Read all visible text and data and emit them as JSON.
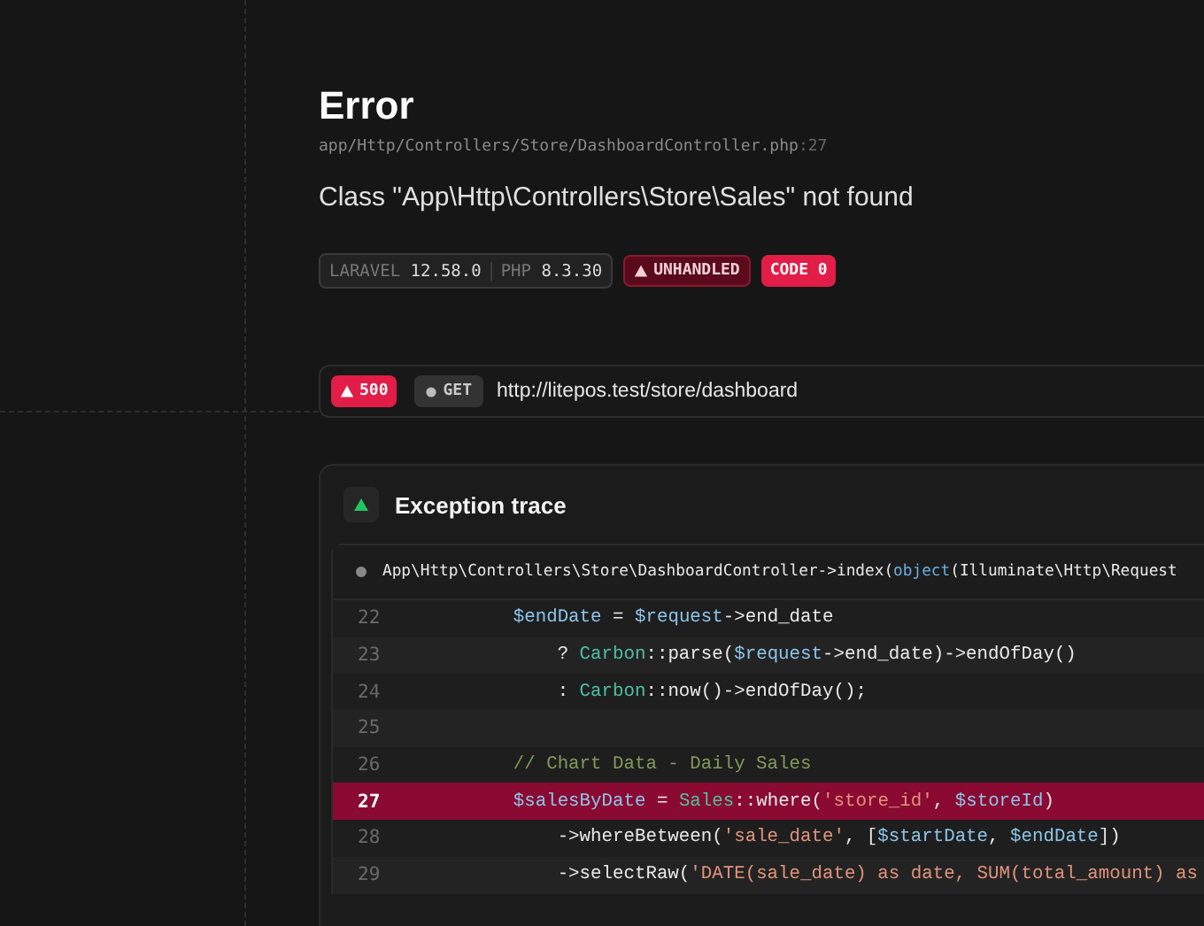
{
  "title": "Error",
  "file": {
    "path": "app/Http/Controllers/Store/DashboardController.php",
    "line": ":27"
  },
  "message": "Class \"App\\Http\\Controllers\\Store\\Sales\" not found",
  "versions": [
    {
      "name": "LARAVEL",
      "value": "12.58.0"
    },
    {
      "name": "PHP",
      "value": "8.3.30"
    }
  ],
  "badges": [
    {
      "kind": "unhandled",
      "label": "UNHANDLED"
    },
    {
      "kind": "code",
      "label": "CODE 0"
    }
  ],
  "request": {
    "status": "500",
    "method": "GET",
    "url": "http://litepos.test/store/dashboard"
  },
  "trace": {
    "title": "Exception trace",
    "frame": [
      {
        "kind": "plain",
        "s": "App\\Http\\Controllers\\Store\\DashboardController->index("
      },
      {
        "kind": "kw",
        "s": "object"
      },
      {
        "kind": "plain",
        "s": "(Illuminate\\Http\\Request"
      }
    ],
    "lines": [
      {
        "number": "22",
        "highlighted": false,
        "tokens": [
          {
            "kind": "var",
            "s": "        $endDate"
          },
          {
            "kind": "plain",
            "s": " = "
          },
          {
            "kind": "var",
            "s": "$request"
          },
          {
            "kind": "plain",
            "s": "->end_date"
          }
        ]
      },
      {
        "number": "23",
        "highlighted": false,
        "tokens": [
          {
            "kind": "plain",
            "s": "            ? "
          },
          {
            "kind": "cls",
            "s": "Carbon"
          },
          {
            "kind": "plain",
            "s": "::parse("
          },
          {
            "kind": "var",
            "s": "$request"
          },
          {
            "kind": "plain",
            "s": "->end_date)->endOfDay()"
          }
        ]
      },
      {
        "number": "24",
        "highlighted": false,
        "tokens": [
          {
            "kind": "plain",
            "s": "            : "
          },
          {
            "kind": "cls",
            "s": "Carbon"
          },
          {
            "kind": "plain",
            "s": "::now()->endOfDay();"
          }
        ]
      },
      {
        "number": "25",
        "highlighted": false
      },
      {
        "number": "26",
        "highlighted": false,
        "tokens": [
          {
            "kind": "cmt",
            "s": "        // Chart Data - Daily Sales"
          }
        ]
      },
      {
        "number": "27",
        "highlighted": true,
        "tokens": [
          {
            "kind": "var",
            "s": "        $salesByDate"
          },
          {
            "kind": "plain",
            "s": " = "
          },
          {
            "kind": "cls",
            "s": "Sales"
          },
          {
            "kind": "plain",
            "s": "::where("
          },
          {
            "kind": "str",
            "s": "'store_id'"
          },
          {
            "kind": "plain",
            "s": ", "
          },
          {
            "kind": "var",
            "s": "$storeId"
          },
          {
            "kind": "plain",
            "s": ")"
          }
        ]
      },
      {
        "number": "28",
        "highlighted": false,
        "tokens": [
          {
            "kind": "plain",
            "s": "            ->whereBetween("
          },
          {
            "kind": "str",
            "s": "'sale_date'"
          },
          {
            "kind": "plain",
            "s": ", ["
          },
          {
            "kind": "var",
            "s": "$startDate"
          },
          {
            "kind": "plain",
            "s": ", "
          },
          {
            "kind": "var",
            "s": "$endDate"
          },
          {
            "kind": "plain",
            "s": "])"
          }
        ]
      },
      {
        "number": "29",
        "highlighted": false,
        "tokens": [
          {
            "kind": "plain",
            "s": "            ->selectRaw("
          },
          {
            "kind": "str",
            "s": "'DATE(sale_date) as date, SUM(total_amount) as"
          }
        ]
      }
    ]
  }
}
